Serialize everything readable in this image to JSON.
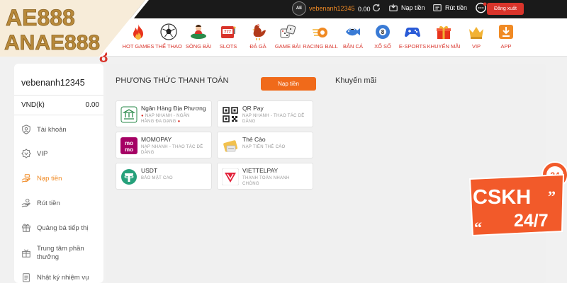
{
  "brand": {
    "logo_line1": "AE888",
    "logo_line2": "ANAE888",
    "nav_number": "8"
  },
  "topbar": {
    "avatar_text": "AE",
    "username": "vebenanh12345",
    "balance": "0.00",
    "deposit_label": "Nạp tiền",
    "withdraw_label": "Rút tiền",
    "logout_label": "Đăng xuất"
  },
  "nav": {
    "items": [
      {
        "label": "HOT GAMES",
        "icon": "flame-icon"
      },
      {
        "label": "THỂ THAO",
        "icon": "soccer-ball-icon"
      },
      {
        "label": "SÒNG BÀI",
        "icon": "casino-dealer-icon"
      },
      {
        "label": "SLOTS",
        "icon": "slot-machine-icon"
      },
      {
        "label": "ĐÁ GÀ",
        "icon": "rooster-icon"
      },
      {
        "label": "GAME BÀI",
        "icon": "dice-icon"
      },
      {
        "label": "RACING BALL",
        "icon": "racing-ball-icon"
      },
      {
        "label": "BẮN CÁ",
        "icon": "fish-icon"
      },
      {
        "label": "XỔ SỐ",
        "icon": "lottery-ball-icon"
      },
      {
        "label": "E-SPORTS",
        "icon": "gamepad-icon"
      },
      {
        "label": "KHUYẾN MÃI",
        "icon": "gift-icon"
      },
      {
        "label": "VIP",
        "icon": "crown-icon"
      },
      {
        "label": "APP",
        "icon": "download-icon"
      }
    ]
  },
  "sidebar": {
    "username": "vebenanh12345",
    "currency": "VND(k)",
    "amount": "0.00",
    "items": [
      {
        "label": "Tài khoản",
        "icon": "user-shield-icon"
      },
      {
        "label": "VIP",
        "icon": "vip-badge-icon"
      },
      {
        "label": "Nạp tiền",
        "icon": "deposit-hand-icon",
        "active": true
      },
      {
        "label": "Rút tiền",
        "icon": "withdraw-icon"
      },
      {
        "label": "Quảng bá tiếp thị",
        "icon": "marketing-icon"
      },
      {
        "label": "Trung tâm phần thưởng",
        "line1": "Trung tâm phần",
        "line2": "thưởng",
        "icon": "reward-icon"
      },
      {
        "label": "Nhật ký nhiệm vụ",
        "icon": "task-log-icon"
      }
    ]
  },
  "main": {
    "title": "PHƯƠNG THỨC THANH TOÁN",
    "deposit_button": "Nạp tiền",
    "promo_title": "Khuyến mãi",
    "methods": [
      {
        "name": "Ngân Hàng Địa Phương",
        "desc1": "NẠP NHANH - NGÂN",
        "desc2": "HÀNG ĐA DẠNG",
        "icon": "bank-icon"
      },
      {
        "name": "QR Pay",
        "desc1": "NẠP NHANH - THAO TÁC DỄ",
        "desc2": "DÀNG",
        "icon": "qr-code-icon"
      },
      {
        "name": "MOMOPAY",
        "desc1": "NẠP NHANH - THAO TÁC DỄ",
        "desc2": "DÀNG",
        "icon": "momo-icon",
        "icon_text1": "mo",
        "icon_text2": "mo"
      },
      {
        "name": "Thẻ Cào",
        "desc1": "NẠP TIỀN THẺ CÀO",
        "desc2": "",
        "icon": "scratch-card-icon"
      },
      {
        "name": "USDT",
        "desc1": "BẢO MẬT CAO",
        "desc2": "",
        "icon": "tether-icon"
      },
      {
        "name": "VIETTELPAY",
        "desc1": "THANH TOÁN NHANH",
        "desc2": "CHÓNG",
        "icon": "viettelpay-icon"
      }
    ]
  },
  "cskh": {
    "text1": "CSKH",
    "text2": "24/7",
    "clock_text": "24"
  },
  "colors": {
    "accent": "#f06a1a",
    "brand_red": "#d9342b",
    "topbar": "#1a1a1a",
    "logo_gold": "#b8893a"
  }
}
